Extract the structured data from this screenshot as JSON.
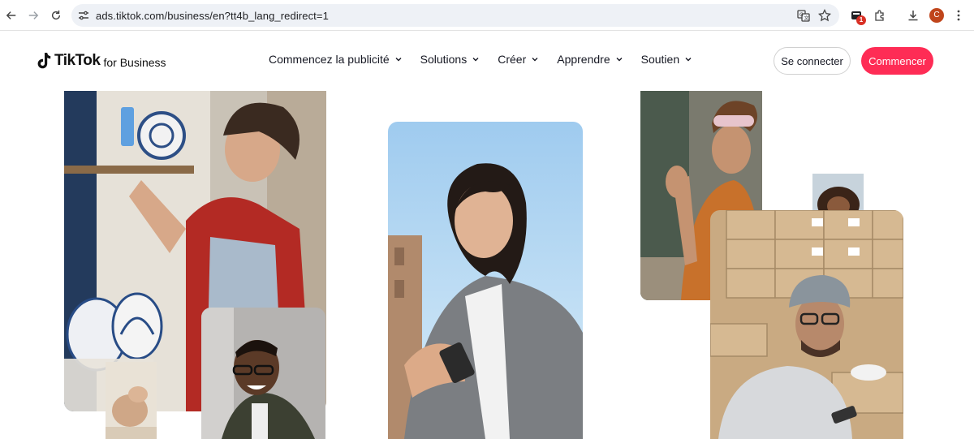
{
  "browser": {
    "url": "ads.tiktok.com/business/en?tt4b_lang_redirect=1",
    "extension_badge": "1",
    "profile_initial": "C",
    "icons": [
      "back-icon",
      "forward-icon",
      "reload-icon",
      "site-info-icon",
      "translate-icon",
      "star-icon",
      "extension-icon",
      "puzzle-icon",
      "download-icon",
      "more-icon"
    ]
  },
  "header": {
    "logo_word": "TikTok",
    "logo_sub": "for Business",
    "menu": [
      {
        "label": "Commencez la publicité"
      },
      {
        "label": "Solutions"
      },
      {
        "label": "Créer"
      },
      {
        "label": "Apprendre"
      },
      {
        "label": "Soutien"
      }
    ],
    "login_label": "Se connecter",
    "start_label": "Commencer"
  },
  "colors": {
    "accent": "#fe2c55",
    "text": "#161823",
    "omnibox": "#eef1f6"
  }
}
